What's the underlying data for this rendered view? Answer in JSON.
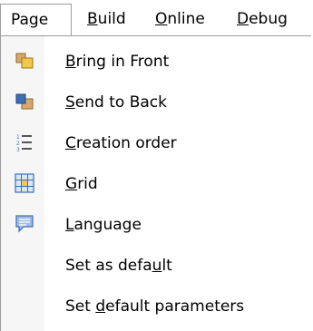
{
  "menubar": {
    "items": [
      {
        "label": "Page",
        "mnemonic_index": 2
      },
      {
        "label": "Build",
        "mnemonic_index": 0
      },
      {
        "label": "Online",
        "mnemonic_index": 0
      },
      {
        "label": "Debug",
        "mnemonic_index": 0
      }
    ]
  },
  "dropdown": {
    "items": [
      {
        "label": "Bring in Front",
        "icon": "bring-to-front-icon",
        "mnemonic_index": 0
      },
      {
        "label": "Send to Back",
        "icon": "send-to-back-icon",
        "mnemonic_index": 0
      },
      {
        "label": "Creation order",
        "icon": "creation-order-icon",
        "mnemonic_index": 0
      },
      {
        "label": "Grid",
        "icon": "grid-icon",
        "mnemonic_index": 0
      },
      {
        "label": "Language",
        "icon": "language-icon",
        "mnemonic_index": 0
      },
      {
        "label": "Set as default",
        "icon": "",
        "mnemonic_index": 11
      },
      {
        "label": "Set default parameters",
        "icon": "",
        "mnemonic_index": 4
      }
    ]
  },
  "colors": {
    "border": "#9c9c9c",
    "gutter": "#f6f6f6",
    "icon_yellow": "#f2c84b",
    "icon_blue": "#3d6fb8",
    "icon_tan": "#d8a869"
  }
}
